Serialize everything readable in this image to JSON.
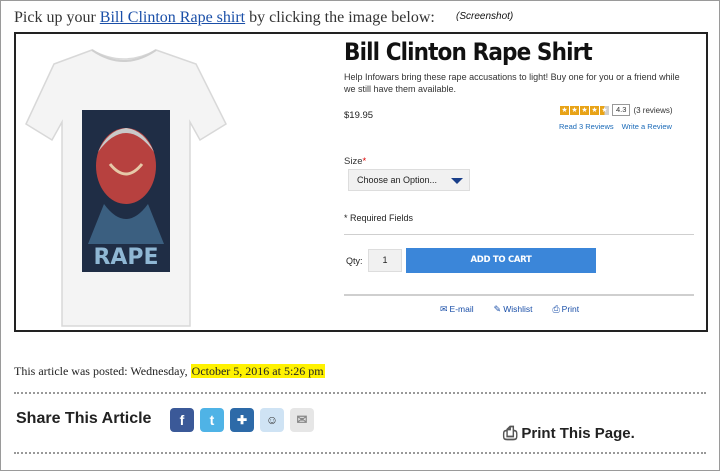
{
  "intro": {
    "prefix": "Pick up your ",
    "link": "Bill Clinton Rape shirt",
    "suffix": " by clicking the image below:",
    "caption": "(Screenshot)"
  },
  "product": {
    "title": "Bill Clinton Rape Shirt",
    "description": "Help Infowars bring these rape accusations to light! Buy one for you or a friend while we still have them available.",
    "price": "$19.95",
    "rating": {
      "score": "4.3",
      "reviews": "(3 reviews)",
      "stars_filled": 4.3,
      "read_link": "Read 3 Reviews",
      "write_link": "Write a Review"
    },
    "shirt_text": "RAPE",
    "size_label": "Size",
    "size_required_mark": "*",
    "size_selected": "Choose an Option...",
    "required_note": "* Required Fields",
    "qty_label": "Qty:",
    "qty_value": "1",
    "add_to_cart": "ADD TO CART",
    "links": {
      "email": "E-mail",
      "wishlist": "Wishlist",
      "print": "Print"
    }
  },
  "article": {
    "posted_prefix": "This article was posted: Wednesday, ",
    "posted_date": "October 5, 2016 at 5:26 pm",
    "share_title": "Share This Article",
    "print_page": "Print This Page."
  },
  "colors": {
    "link": "#1a4fa8",
    "cart_button": "#3b86d9",
    "highlight": "#fff200",
    "facebook": "#3b5998",
    "twitter": "#4fb3e6"
  }
}
